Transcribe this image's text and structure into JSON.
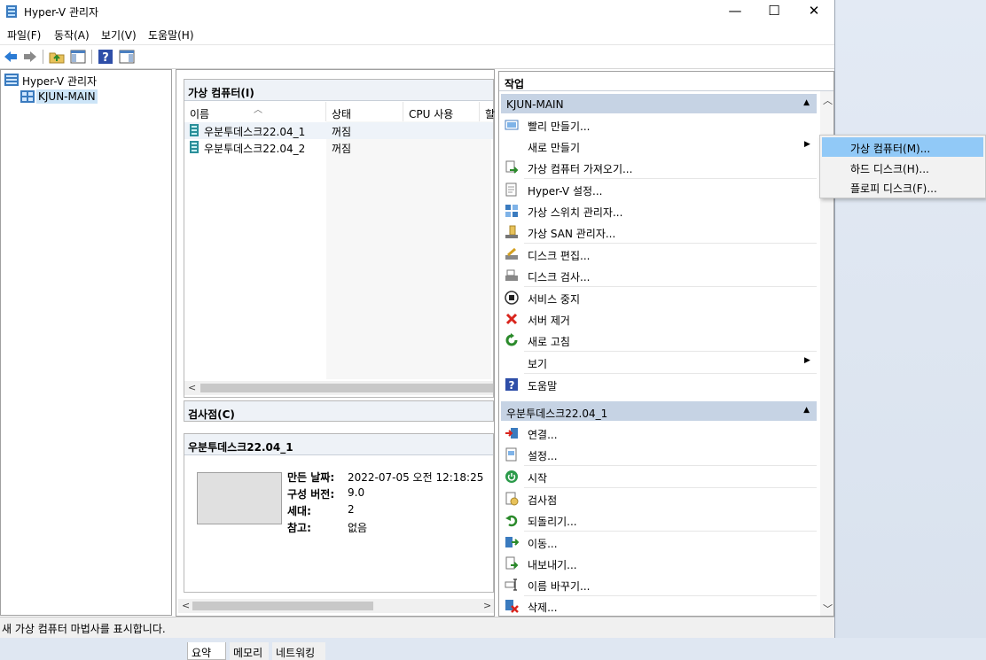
{
  "window": {
    "title": "Hyper-V 관리자"
  },
  "menu": [
    "파일(F)",
    "동작(A)",
    "보기(V)",
    "도움말(H)"
  ],
  "tree": {
    "root": "Hyper-V 관리자",
    "server": "KJUN-MAIN"
  },
  "vm_pane": {
    "title": "가상 컴퓨터(I)",
    "columns": [
      "이름",
      "상태",
      "CPU 사용",
      "할"
    ],
    "rows": [
      {
        "name": "우분투데스크22.04_1",
        "state": "꺼짐"
      },
      {
        "name": "우분투데스크22.04_2",
        "state": "꺼짐"
      }
    ]
  },
  "checkpoint_pane": {
    "title": "검사점(C)"
  },
  "details_pane": {
    "title": "우분투데스크22.04_1",
    "fields": [
      {
        "label": "만든 날짜:",
        "value": "2022-07-05 오전 12:18:25"
      },
      {
        "label": "구성 버전:",
        "value": "9.0"
      },
      {
        "label": "세대:",
        "value": "2"
      },
      {
        "label": "참고:",
        "value": "없음"
      }
    ],
    "tabs": [
      "요약",
      "메모리",
      "네트워킹"
    ]
  },
  "actions_pane": {
    "title": "작업",
    "server_section": "KJUN-MAIN",
    "server_actions": [
      "빨리 만들기...",
      "새로 만들기",
      "가상 컴퓨터 가져오기...",
      "Hyper-V 설정...",
      "가상 스위치 관리자...",
      "가상 SAN 관리자...",
      "디스크 편집...",
      "디스크 검사...",
      "서비스 중지",
      "서버 제거",
      "새로 고침",
      "보기",
      "도움말"
    ],
    "vm_section": "우분투데스크22.04_1",
    "vm_actions": [
      "연결...",
      "설정...",
      "시작",
      "검사점",
      "되돌리기...",
      "이동...",
      "내보내기...",
      "이름 바꾸기...",
      "삭제..."
    ]
  },
  "context_menu": [
    "가상 컴퓨터(M)...",
    "하드 디스크(H)...",
    "플로피 디스크(F)..."
  ],
  "status": "새 가상 컴퓨터 마법사를 표시합니다."
}
